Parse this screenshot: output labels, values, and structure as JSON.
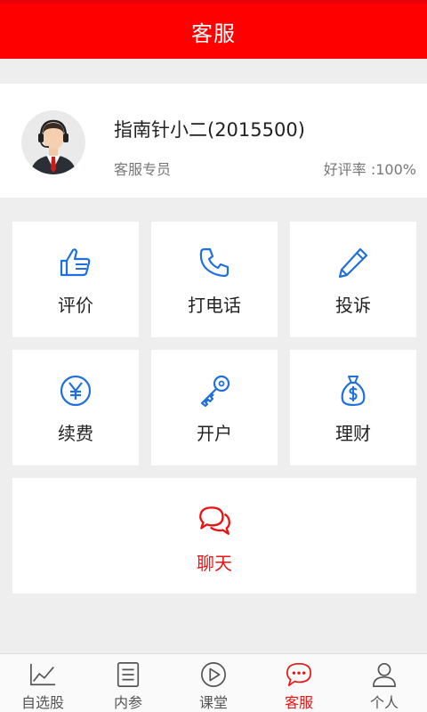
{
  "header": {
    "title": "客服"
  },
  "agent": {
    "name": "指南针小二(2015500)",
    "role": "客服专员",
    "rating": "好评率 :100%"
  },
  "services": [
    {
      "label": "评价",
      "icon": "thumbs-up-icon"
    },
    {
      "label": "打电话",
      "icon": "phone-icon"
    },
    {
      "label": "投诉",
      "icon": "pencil-icon"
    },
    {
      "label": "续费",
      "icon": "yuan-coin-icon"
    },
    {
      "label": "开户",
      "icon": "key-icon"
    },
    {
      "label": "理财",
      "icon": "money-bag-icon"
    }
  ],
  "chat": {
    "label": "聊天",
    "icon": "chat-bubbles-icon"
  },
  "tabs": [
    {
      "label": "自选股",
      "icon": "stock-chart-icon"
    },
    {
      "label": "内参",
      "icon": "document-icon"
    },
    {
      "label": "课堂",
      "icon": "play-icon"
    },
    {
      "label": "客服",
      "icon": "chat-icon",
      "active": true
    },
    {
      "label": "个人",
      "icon": "person-icon"
    }
  ],
  "colors": {
    "brand": "#ff0000",
    "accent_blue": "#1e6fe0",
    "active_tab": "#ee1111"
  }
}
